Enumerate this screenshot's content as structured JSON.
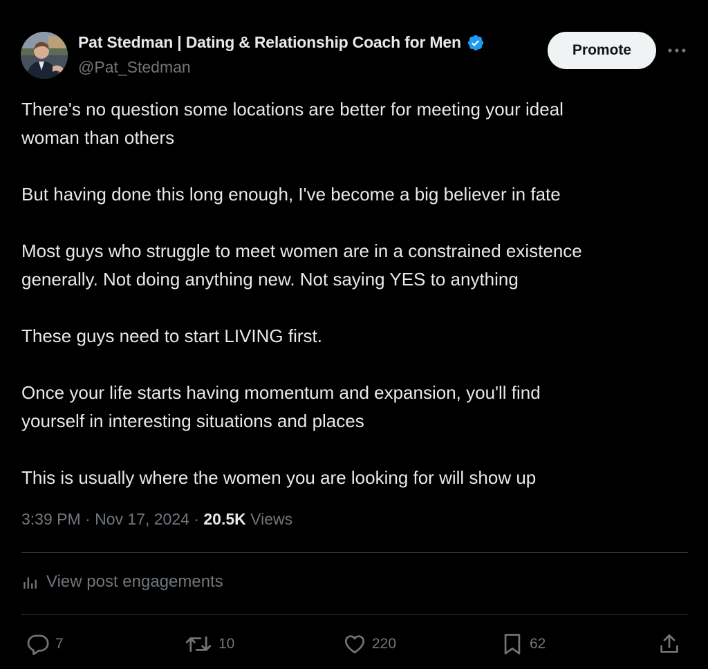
{
  "author": {
    "display_name": "Pat Stedman | Dating & Relationship Coach for Men",
    "handle": "@Pat_Stedman",
    "verified": true
  },
  "header": {
    "promote_label": "Promote"
  },
  "post": {
    "paragraphs": [
      "There's no question some locations are better for meeting your ideal\nwoman than others",
      "But having done this long enough, I've become a big believer in fate",
      "Most guys who struggle to meet women are in a constrained existence\ngenerally. Not doing anything new. Not saying YES to anything",
      "These guys need to start LIVING first.",
      "Once your life starts having momentum and expansion, you'll find\nyourself in interesting situations and places",
      "This is usually where the women you are looking for will show up"
    ],
    "time": "3:39 PM",
    "date": "Nov 17, 2024",
    "views_count": "20.5K",
    "views_label": "Views"
  },
  "engagements_label": "View post engagements",
  "actions": {
    "replies": "7",
    "reposts": "10",
    "likes": "220",
    "bookmarks": "62"
  },
  "colors": {
    "background": "#000000",
    "text_primary": "#e7e9ea",
    "text_secondary": "#71767b",
    "verified": "#1d9bf0",
    "divider": "#2f3336",
    "promote_bg": "#eff3f4"
  },
  "icons": {
    "verified": "verified-badge-icon",
    "more": "more-horizontal-icon",
    "analytics": "analytics-bars-icon",
    "reply": "reply-bubble-icon",
    "repost": "repost-arrows-icon",
    "like": "heart-icon",
    "bookmark": "bookmark-icon",
    "share": "share-upload-icon"
  }
}
